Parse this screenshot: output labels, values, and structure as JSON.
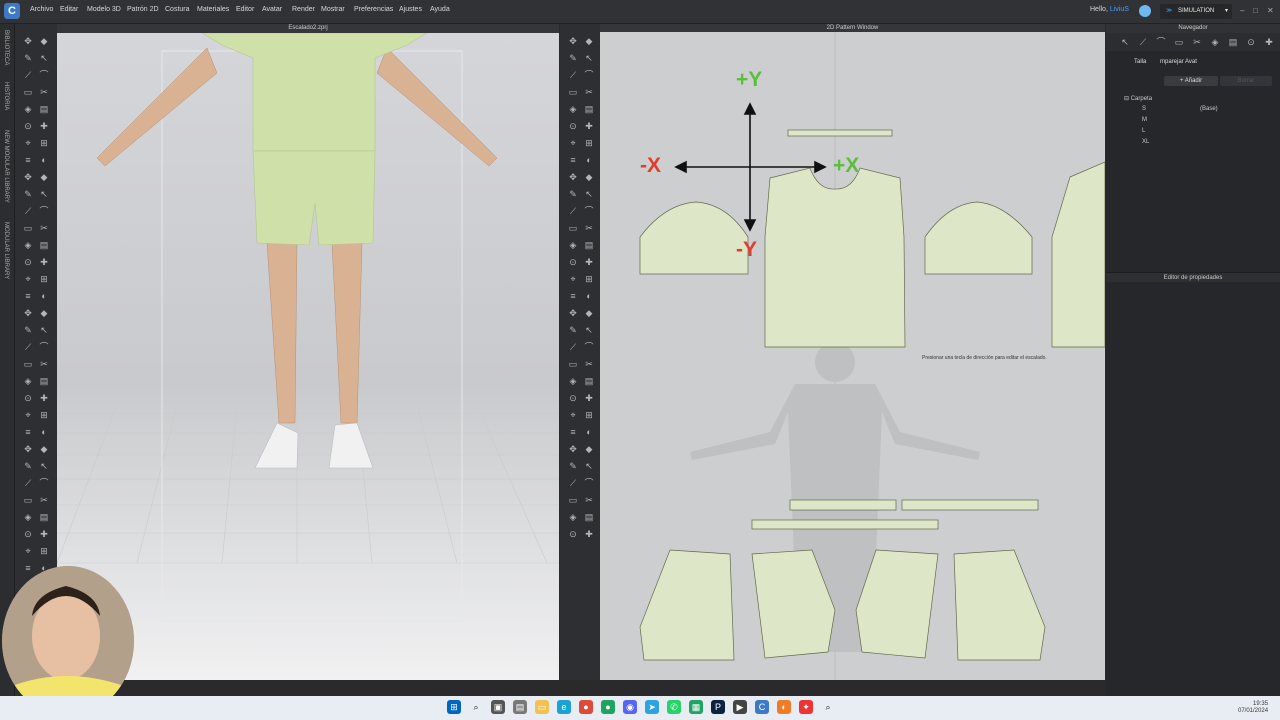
{
  "menubar": {
    "logo_letter": "C",
    "items": [
      "Archivo",
      "Editar",
      "Modelo 3D",
      "Patrón 2D",
      "Costura",
      "Materiales",
      "Editor",
      "Avatar",
      "Render",
      "Mostrar",
      "Preferencias",
      "Ajustes",
      "Ayuda"
    ],
    "greeting_prefix": "Hello,",
    "user": "LiviuS",
    "mode": "SIMULATION",
    "window_buttons": [
      "–",
      "□",
      "✕"
    ]
  },
  "left_strip": {
    "tabs": [
      "BIBLIOTECA",
      "HISTORIA",
      "NEW MODULAR LIBRARY",
      "MODULAR LIBRARY"
    ]
  },
  "view3d": {
    "title": "Escalado2.zprj"
  },
  "view2d": {
    "title": "2D Pattern Window",
    "axis_labels": {
      "plus_y": "+Y",
      "minus_y": "-Y",
      "plus_x": "+X",
      "minus_x": "-X"
    },
    "hint": "Presionar una tecla de dirección para editar el escalado."
  },
  "right_panel": {
    "navigator_title": "Navegador",
    "tabs": [
      "Talla",
      "mparejar Avat"
    ],
    "add_label": "+ Añadir",
    "delete_label": "Borrar",
    "folder": "Carpeta",
    "sizes": [
      {
        "name": "S",
        "tag": "(Base)"
      },
      {
        "name": "M",
        "tag": ""
      },
      {
        "name": "L",
        "tag": ""
      },
      {
        "name": "XL",
        "tag": ""
      }
    ],
    "properties_title": "Editor de propiedades"
  },
  "taskbar": {
    "time": "19:35",
    "date": "07/01/2024"
  },
  "colors": {
    "accent": "#3fa0ff",
    "fabric": "#d8e3c0",
    "seam": "#6ab0e6",
    "axis_green": "#5cbf3c",
    "axis_red": "#e23d2b"
  }
}
